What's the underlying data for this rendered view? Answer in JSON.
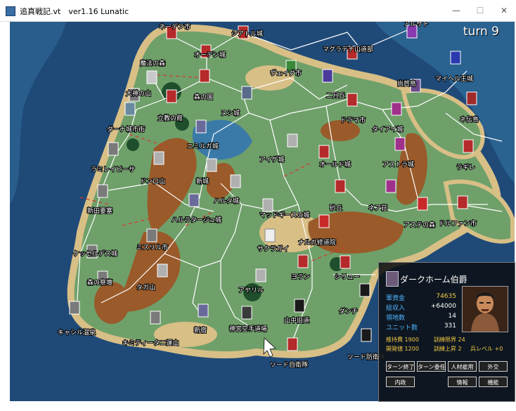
{
  "window": {
    "title": "追真戦記.vt　ver1.16 Lunatic",
    "minimize": "—",
    "maximize": "☐",
    "close": "✕"
  },
  "hud": {
    "turn": "turn 9"
  },
  "map": {
    "colors": {
      "sea_deep": "#1f4a78",
      "sea_shallow": "#3a7aa8",
      "land": "#6fa06a",
      "sand": "#d8bf86",
      "mountain": "#9a5a2a",
      "road": "#ffffff",
      "enemy_road": "#d23a2a"
    },
    "towns": [
      {
        "name": "ネーデン市"
      },
      {
        "name": "シアトル城"
      },
      {
        "name": "アルサト"
      },
      {
        "name": "オーデン城"
      },
      {
        "name": "マグラデナ山道部"
      },
      {
        "name": "魔法の森"
      },
      {
        "name": "ヴェイグ市"
      },
      {
        "name": "マイヘル王城"
      },
      {
        "name": "森の国"
      },
      {
        "name": "大神の山"
      },
      {
        "name": "二月丘"
      },
      {
        "name": "尚賀島"
      },
      {
        "name": "立教の館"
      },
      {
        "name": "ヌシ城"
      },
      {
        "name": "ドラマ市"
      },
      {
        "name": "タイアイ城"
      },
      {
        "name": "ネ伝島"
      },
      {
        "name": "ダーナ城市街"
      },
      {
        "name": "アイゲ城"
      },
      {
        "name": "アストラ城"
      },
      {
        "name": "ラギレ"
      },
      {
        "name": "ニミルガ城"
      },
      {
        "name": "オールド城"
      },
      {
        "name": "ラミレイピーサ"
      },
      {
        "name": "ドンロ山"
      },
      {
        "name": "新城"
      },
      {
        "name": "砂丘"
      },
      {
        "name": "ハルタ城"
      },
      {
        "name": "新田要塞"
      },
      {
        "name": "ネア荘"
      },
      {
        "name": "ハルラタージュ城"
      },
      {
        "name": "マッドギースの城"
      },
      {
        "name": "アステの森"
      },
      {
        "name": "ケッセルデス城"
      },
      {
        "name": "ナルガ修道院"
      },
      {
        "name": "サクラガイ"
      },
      {
        "name": "ミスリル市"
      },
      {
        "name": "アヤリル"
      },
      {
        "name": "ヨラン"
      },
      {
        "name": "タガ山"
      },
      {
        "name": "シリュー"
      },
      {
        "name": "キャシル温泉"
      },
      {
        "name": "森の祭壇"
      },
      {
        "name": "キミティータニ運山"
      },
      {
        "name": "山中旧道"
      },
      {
        "name": "新宿"
      },
      {
        "name": "神宮空手道場"
      },
      {
        "name": "ソード自衛隊"
      },
      {
        "name": "ソード防衛隊"
      },
      {
        "name": "ダンチ"
      },
      {
        "name": "ドルファン市"
      }
    ]
  },
  "panel": {
    "name": "ダークホーム伯爵",
    "rows": [
      {
        "label": "軍資金",
        "value": "74635"
      },
      {
        "label": "総収入",
        "value": "+64000"
      },
      {
        "label": "領地数",
        "value": "14"
      },
      {
        "label": "ユニット数",
        "value": "331"
      }
    ],
    "sub": [
      {
        "label": "維持費",
        "value": "1900"
      },
      {
        "label": "訓練限界",
        "value": "24"
      },
      {
        "label": "開発値",
        "value": "1200"
      },
      {
        "label": "訓練上昇",
        "value": "2"
      },
      {
        "label": "兵レベル",
        "value": "+0"
      }
    ],
    "buttons": {
      "end_turn": "ターン終了",
      "delegate": "ターン委任",
      "hire": "人材雇用",
      "diplomacy": "外交",
      "internal": "内政",
      "info": "情報",
      "function": "機能"
    }
  }
}
